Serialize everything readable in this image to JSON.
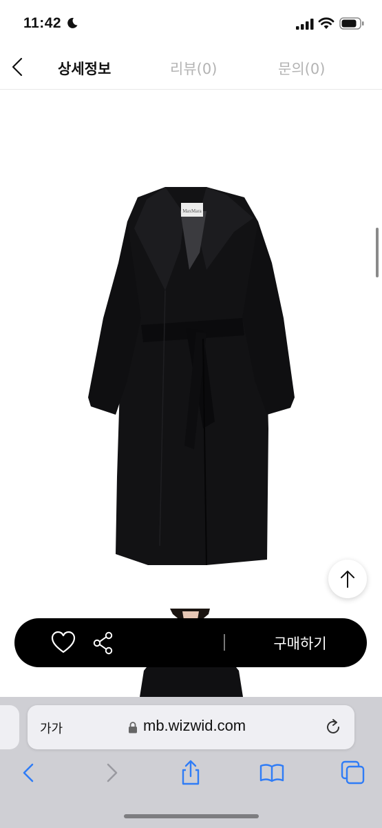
{
  "status_bar": {
    "time": "11:42",
    "icons": [
      "moon-icon",
      "signal-icon",
      "wifi-icon",
      "battery-icon"
    ]
  },
  "tabs": [
    {
      "label": "상세정보",
      "active": true
    },
    {
      "label": "리뷰(0)",
      "active": false
    },
    {
      "label": "문의(0)",
      "active": false
    }
  ],
  "product": {
    "label_text": "MaxMara",
    "images": [
      "black-belted-coat",
      "model-wearing-coat"
    ]
  },
  "purchase_bar": {
    "buy_label": "구매하기",
    "icons": [
      "heart-icon",
      "share-icon"
    ]
  },
  "browser": {
    "aa_label": "가가",
    "url": "mb.wizwid.com",
    "toolbar_icons": [
      "back-icon",
      "forward-icon",
      "share-icon",
      "bookmarks-icon",
      "tabs-icon"
    ]
  },
  "colors": {
    "accent": "#2f7cf6",
    "disabled": "#9a9aa0",
    "purchase_bar_bg": "#000000",
    "tab_inactive": "#b3b3b3"
  }
}
